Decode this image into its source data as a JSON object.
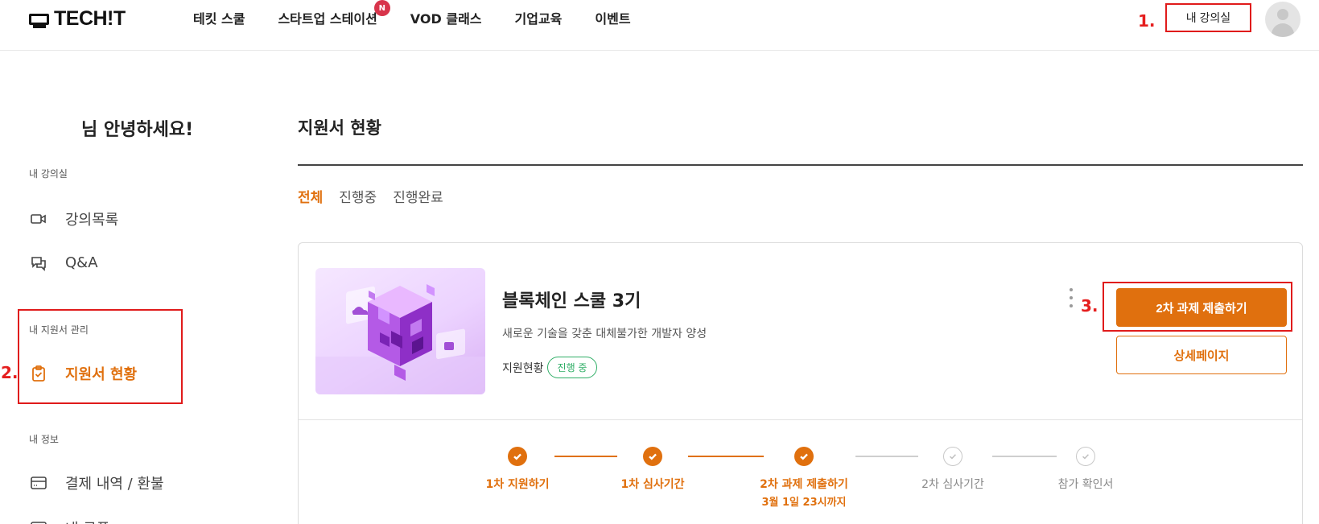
{
  "header": {
    "logo_text": "TECH!T",
    "nav": [
      {
        "label": "테킷 스쿨"
      },
      {
        "label": "스타트업 스테이션",
        "badge": "N"
      },
      {
        "label": "VOD 클래스"
      },
      {
        "label": "기업교육"
      },
      {
        "label": "이벤트"
      }
    ],
    "annotation": "1.",
    "classroom_button": "내 강의실"
  },
  "sidebar": {
    "greeting": "님 안녕하세요!",
    "sections": [
      {
        "title": "내 강의실",
        "items": [
          {
            "label": "강의목록",
            "icon": "video-icon"
          },
          {
            "label": "Q&A",
            "icon": "chat-icon"
          }
        ]
      },
      {
        "title": "내 지원서 관리",
        "items": [
          {
            "label": "지원서 현황",
            "icon": "clipboard-check-icon",
            "active": true
          }
        ]
      },
      {
        "title": "내 정보",
        "items": [
          {
            "label": "결제 내역 / 환불",
            "icon": "card-icon"
          },
          {
            "label": "내 쿠폰",
            "icon": "coupon-icon"
          }
        ]
      }
    ],
    "annotation": "2."
  },
  "main": {
    "title": "지원서 현황",
    "tabs": [
      {
        "label": "전체",
        "active": true
      },
      {
        "label": "진행중",
        "active": false
      },
      {
        "label": "진행완료",
        "active": false
      }
    ],
    "card": {
      "title": "블록체인 스쿨 3기",
      "description": "새로운 기술을 갖춘 대체불가한 개발자 양성",
      "status_label": "지원현황",
      "status_badge": "진행 중",
      "annotation": "3.",
      "submit_button": "2차 과제 제출하기",
      "detail_button": "상세페이지",
      "steps": [
        {
          "label": "1차 지원하기",
          "done": true
        },
        {
          "label": "1차 심사기간",
          "done": true
        },
        {
          "label": "2차 과제 제출하기",
          "sub": "3월 1일 23시까지",
          "done": true
        },
        {
          "label": "2차 심사기간",
          "done": false
        },
        {
          "label": "참가 확인서",
          "done": false
        }
      ]
    }
  },
  "colors": {
    "accent": "#e0700e",
    "annotation": "#e51e1e",
    "status": "#2fae66"
  }
}
